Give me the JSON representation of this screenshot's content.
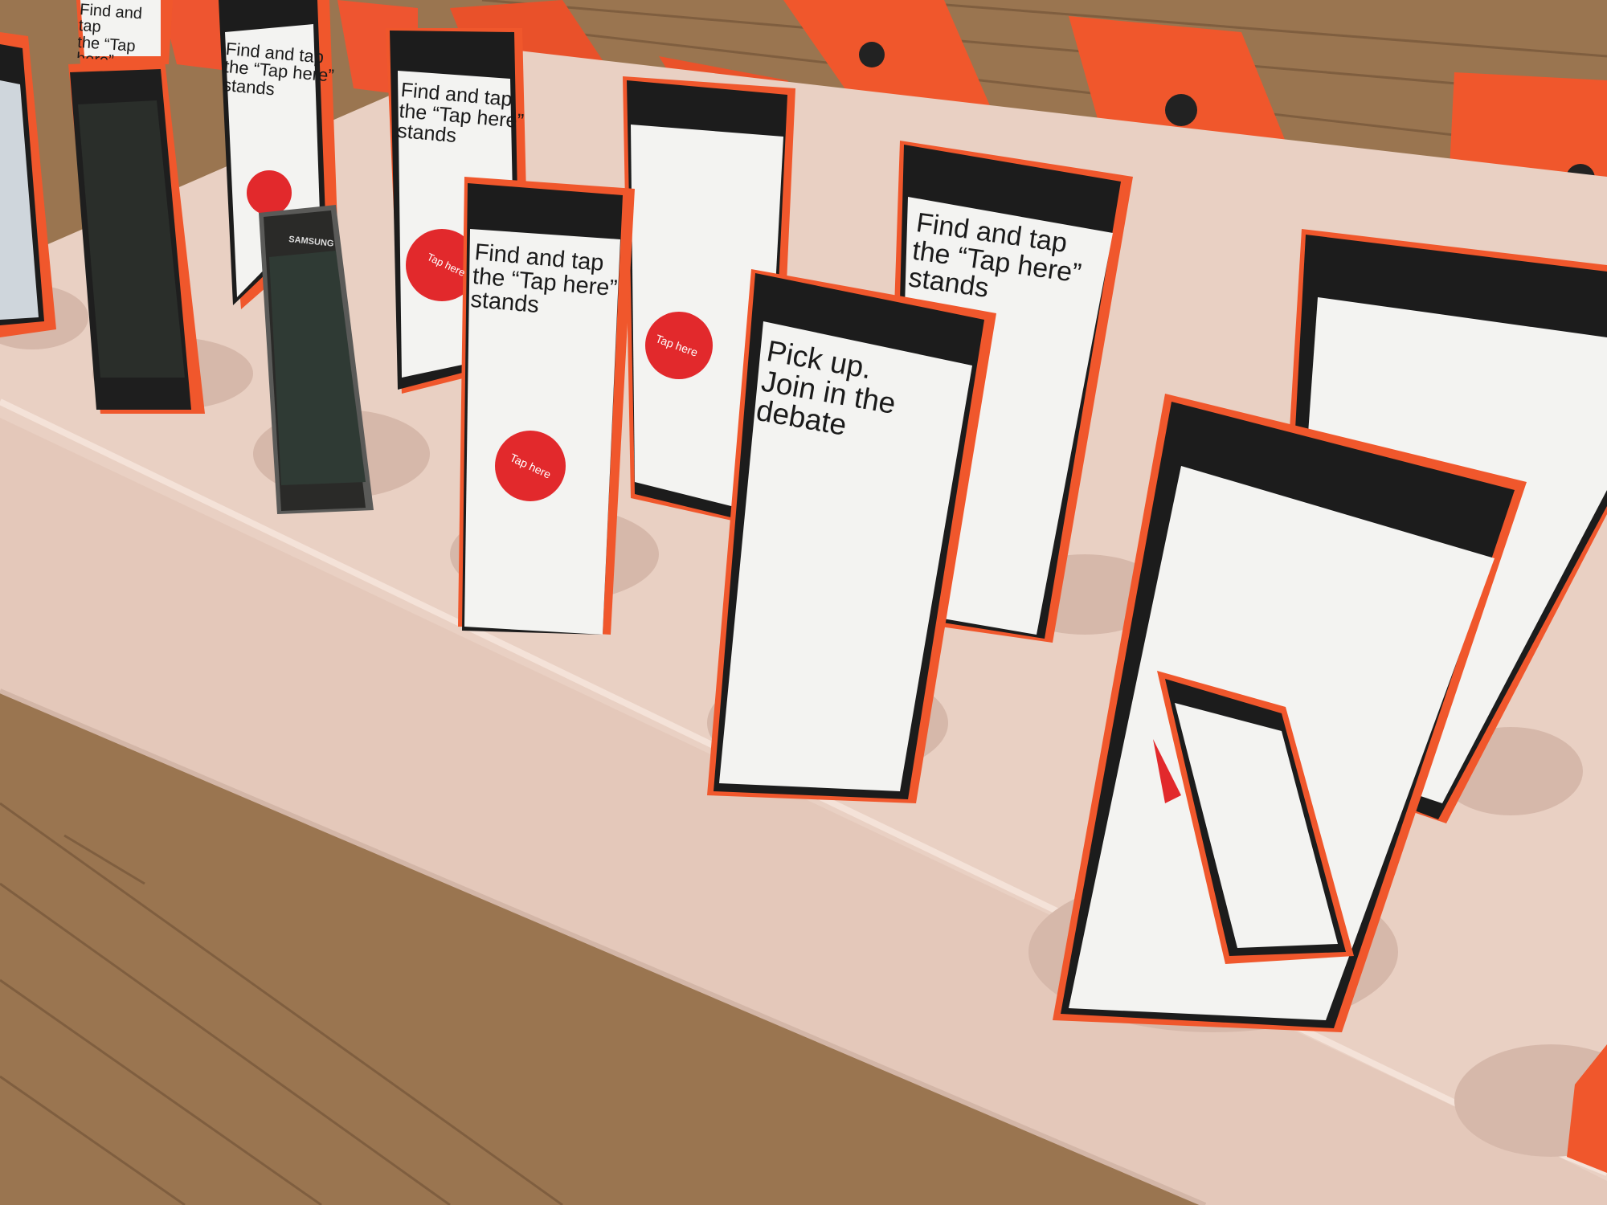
{
  "photo": {
    "colors": {
      "floor": "#9a7550",
      "floor_dark": "#6e5035",
      "table": "#ead2c6",
      "table_shadow": "#cdb1a3",
      "phone_orange": "#f0572c",
      "phone_orange_dark": "#c8401e",
      "bezel": "#1c1c1c",
      "screen": "#f3f3f1",
      "tap_badge": "#e2292c"
    },
    "screens": {
      "find_and_tap": "Find and tap\nthe “Tap here”\nstands",
      "pick_up": "Pick up.\nJoin in the\ndebate",
      "pick_up_partial": "Pick up.\nJoin in the",
      "find_and_tap_partial": "Find and tap\nthe “Tap here”\nstands"
    },
    "badges": {
      "tap_here": "Tap here"
    },
    "brands": {
      "samsung": "SAMSUNG"
    }
  }
}
